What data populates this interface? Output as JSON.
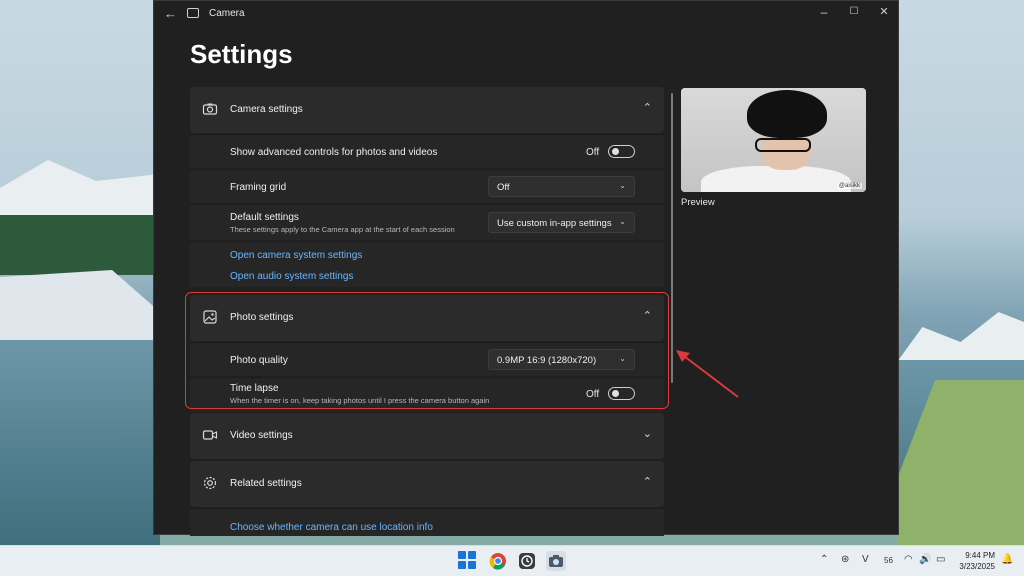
{
  "window": {
    "app_title": "Camera",
    "back_glyph": "←",
    "minimize_glyph": "–",
    "maximize_glyph": "☐",
    "close_glyph": "✕"
  },
  "page_title": "Settings",
  "camera_settings": {
    "header": "Camera settings",
    "advanced_label": "Show advanced controls for photos and videos",
    "advanced_state": "Off",
    "framing_grid_label": "Framing grid",
    "framing_grid_value": "Off",
    "default_settings_label": "Default settings",
    "default_settings_sub": "These settings apply to the Camera app at the start of each session",
    "default_settings_value": "Use custom in-app settings",
    "link_camera": "Open camera system settings",
    "link_audio": "Open audio system settings"
  },
  "photo_settings": {
    "header": "Photo settings",
    "quality_label": "Photo quality",
    "quality_value": "0.9MP 16:9 (1280x720)",
    "timelapse_label": "Time lapse",
    "timelapse_sub": "When the timer is on, keep taking photos until I press the camera button again",
    "timelapse_state": "Off"
  },
  "video_settings": {
    "header": "Video settings"
  },
  "related_settings": {
    "header": "Related settings",
    "link_location": "Choose whether camera can use location info"
  },
  "preview": {
    "label": "Preview",
    "watermark": "@aisikk"
  },
  "taskbar": {
    "time": "9:44 PM",
    "date": "3/23/2025",
    "tray_number": "56"
  },
  "colors": {
    "accent_link": "#6ab7ff",
    "highlight": "#d93b3b",
    "window_bg": "#202020"
  }
}
